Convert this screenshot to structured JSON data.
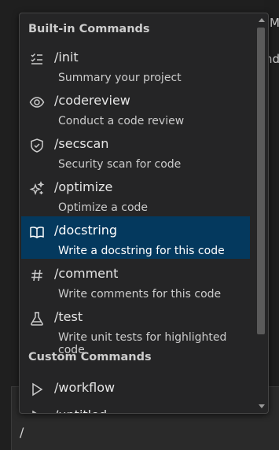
{
  "background": {
    "text_right_1": "M",
    "text_right_2": "ndc"
  },
  "input": {
    "value": "/"
  },
  "popup": {
    "sections": {
      "builtin_header": "Built-in Commands",
      "custom_header": "Custom Commands"
    },
    "items": [
      {
        "icon": "checklist-icon",
        "command": "/init",
        "description": "Summary your project"
      },
      {
        "icon": "eye-icon",
        "command": "/codereview",
        "description": "Conduct a code review"
      },
      {
        "icon": "shield-check-icon",
        "command": "/secscan",
        "description": "Security scan for code"
      },
      {
        "icon": "sparkles-icon",
        "command": "/optimize",
        "description": "Optimize a code"
      },
      {
        "icon": "book-icon",
        "command": "/docstring",
        "description": "Write a docstring for this code",
        "selected": true
      },
      {
        "icon": "hash-icon",
        "command": "/comment",
        "description": "Write comments for this code"
      },
      {
        "icon": "beaker-icon",
        "command": "/test",
        "description": "Write unit tests for highlighted code"
      }
    ],
    "custom_items": [
      {
        "icon": "play-icon",
        "command": "/workflow"
      },
      {
        "icon": "play-icon",
        "command": "/untitled"
      }
    ]
  },
  "colors": {
    "selected_background": "#04395e",
    "popup_background": "#252526"
  }
}
